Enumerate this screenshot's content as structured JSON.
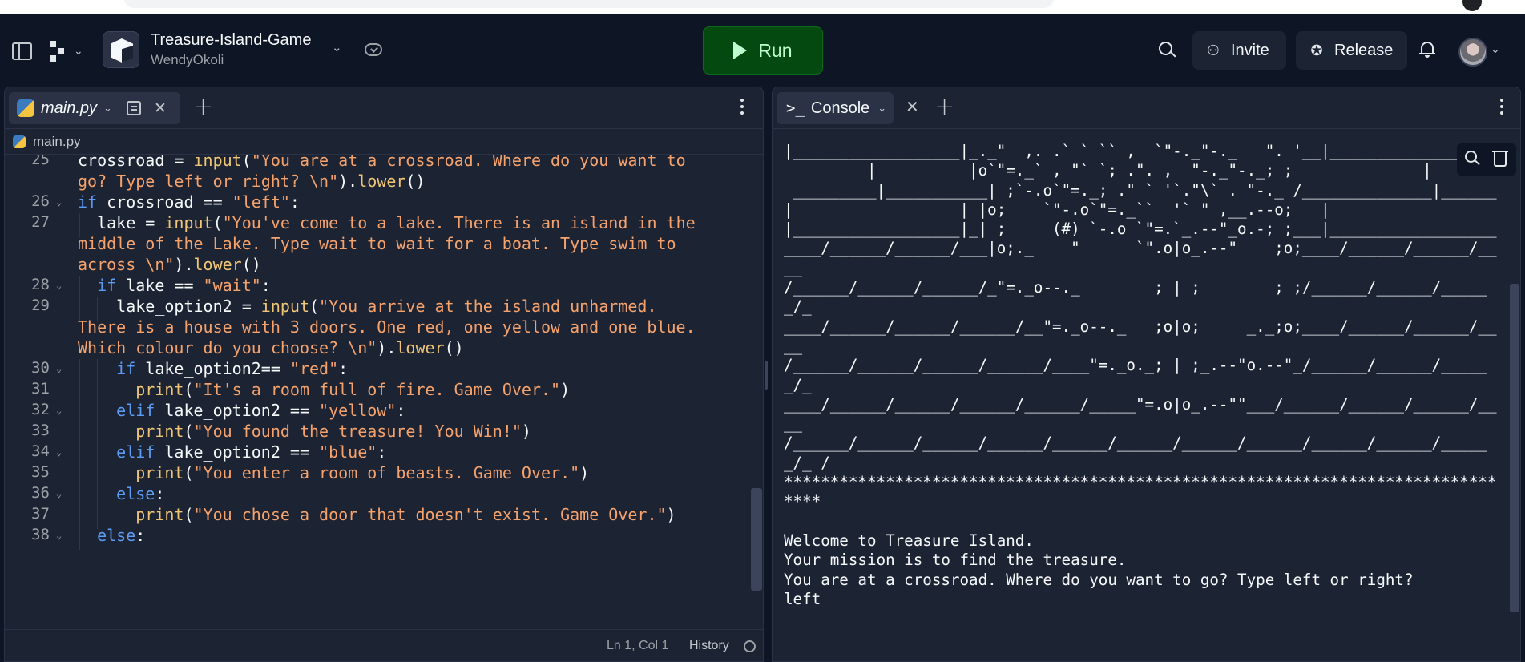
{
  "repl": {
    "title": "Treasure-Island-Game",
    "owner": "WendyOkoli"
  },
  "toolbar": {
    "run_label": "Run",
    "invite_label": "Invite",
    "release_label": "Release"
  },
  "editor": {
    "tab_label": "main.py",
    "breadcrumb": "main.py",
    "lines": [
      {
        "n": "25",
        "fold": false,
        "indent": 0,
        "html": "<span>crossroad = </span><span class=\"fn\">input</span><span>(</span><span class=\"str\">\"You are at a crossroad. Where do you want to</span>"
      },
      {
        "n": "",
        "fold": false,
        "indent": 0,
        "html": "<span class=\"str\">go? Type left or right? \\n\"</span><span>).</span><span class=\"fn\">lower</span><span>()</span>"
      },
      {
        "n": "26",
        "fold": true,
        "indent": 0,
        "html": "<span class=\"kw\">if</span><span> crossroad == </span><span class=\"str\">\"left\"</span><span>:</span>"
      },
      {
        "n": "27",
        "fold": false,
        "indent": 1,
        "html": "<span>  lake = </span><span class=\"fn\">input</span><span>(</span><span class=\"str\">\"You've come to a lake. There is an island in the</span>"
      },
      {
        "n": "",
        "fold": false,
        "indent": 0,
        "html": "<span class=\"str\">middle of the Lake. Type wait to wait for a boat. Type swim to</span>"
      },
      {
        "n": "",
        "fold": false,
        "indent": 0,
        "html": "<span class=\"str\">across \\n\"</span><span>).</span><span class=\"fn\">lower</span><span>()</span>"
      },
      {
        "n": "28",
        "fold": true,
        "indent": 1,
        "html": "<span class=\"kw\">  if</span><span> lake == </span><span class=\"str\">\"wait\"</span><span>:</span>"
      },
      {
        "n": "29",
        "fold": false,
        "indent": 2,
        "html": "<span>    lake_option2 = </span><span class=\"fn\">input</span><span>(</span><span class=\"str\">\"You arrive at the island unharmed.</span>"
      },
      {
        "n": "",
        "fold": false,
        "indent": 0,
        "html": "<span class=\"str\">There is a house with 3 doors. One red, one yellow and one blue.</span>"
      },
      {
        "n": "",
        "fold": false,
        "indent": 0,
        "html": "<span class=\"str\">Which colour do you choose? \\n\"</span><span>).</span><span class=\"fn\">lower</span><span>()</span>"
      },
      {
        "n": "30",
        "fold": true,
        "indent": 2,
        "html": "<span class=\"kw\">    if</span><span> lake_option2== </span><span class=\"str\">\"red\"</span><span>:</span>"
      },
      {
        "n": "31",
        "fold": false,
        "indent": 3,
        "html": "<span>      </span><span class=\"fn\">print</span><span>(</span><span class=\"str\">\"It's a room full of fire. Game Over.\"</span><span>)</span>"
      },
      {
        "n": "32",
        "fold": true,
        "indent": 2,
        "html": "<span class=\"kw\">    elif</span><span> lake_option2 == </span><span class=\"str\">\"yellow\"</span><span>:</span>"
      },
      {
        "n": "33",
        "fold": false,
        "indent": 3,
        "html": "<span>      </span><span class=\"fn\">print</span><span>(</span><span class=\"str\">\"You found the treasure! You Win!\"</span><span>)</span>"
      },
      {
        "n": "34",
        "fold": true,
        "indent": 2,
        "html": "<span class=\"kw\">    elif</span><span> lake_option2 == </span><span class=\"str\">\"blue\"</span><span>:</span>"
      },
      {
        "n": "35",
        "fold": false,
        "indent": 3,
        "html": "<span>      </span><span class=\"fn\">print</span><span>(</span><span class=\"str\">\"You enter a room of beasts. Game Over.\"</span><span>)</span>"
      },
      {
        "n": "36",
        "fold": true,
        "indent": 2,
        "html": "<span class=\"kw\">    else</span><span>:</span>"
      },
      {
        "n": "37",
        "fold": false,
        "indent": 3,
        "html": "<span>      </span><span class=\"fn\">print</span><span>(</span><span class=\"str\">\"You chose a door that doesn't exist. Game Over.\"</span><span>)</span>"
      },
      {
        "n": "38",
        "fold": true,
        "indent": 1,
        "html": "<span class=\"kw\">  else</span><span>:</span>"
      }
    ],
    "status_position": "Ln 1, Col 1",
    "status_history": "History"
  },
  "console": {
    "tab_label": "Console",
    "output": "|__________________|_._\"  ,. .` ` `` ,  `\"-._\"-._   \". '__|______________\n         |          |o`\"=._` , \"` `; .\". ,  \"-._\"-._; ;              |\n _________|___________| ;`-.o`\"=._; .\" ` '`.\"\\` . \"-._ /______________|______\n|                  | |o;    `\"-.o`\"=._``  '` \" ,__.--o;   |\n|__________________|_| ;     (#) `-.o `\"=.`_.--\"_o.-; ;___|__________________\n____/______/______/___|o;._    \"      `\".o|o_.--\"    ;o;____/______/______/____\n/______/______/______/_\"=._o--._        ; | ;        ; ;/______/______/______/_\n____/______/______/______/__\"=._o--._   ;o|o;     _._;o;____/______/______/____\n/______/______/______/______/____\"=._o._; | ;_.--\"o.--\"_/______/______/______/_\n____/______/______/______/______/_____\"=.o|o_.--\"\"___/______/______/______/____\n/______/______/______/______/______/______/______/______/______/______/______/_ /\n*********************************************************************************\n\nWelcome to Treasure Island.\nYour mission is to find the treasure.\nYou are at a crossroad. Where do you want to go? Type left or right?\nleft"
  },
  "colors": {
    "background": "#0e1525",
    "panel": "#1c2333",
    "run_button": "#044a10",
    "keyword": "#5b9cf6",
    "function": "#f0c674",
    "string": "#f6a26b"
  }
}
